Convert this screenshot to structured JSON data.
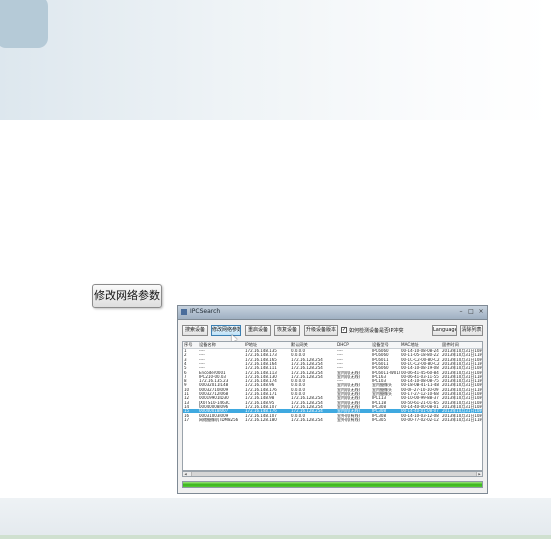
{
  "doc": {
    "callout_button_label": "修改网络参数"
  },
  "app": {
    "title": "IPCSearch",
    "titlebar_buttons": [
      "–",
      "□",
      "×"
    ],
    "toolbar": {
      "search_label": "搜索设备",
      "modify_network_label": "修改网络参数",
      "restart_label": "重启设备",
      "restore_label": "恢复设备",
      "upgrade_label": "升级设备版本",
      "auto_modify_checkbox_checked": true,
      "auto_modify_label": "如何检测设备是否IP冲突",
      "language_label": "Language",
      "clear_list_label": "清除列表"
    },
    "table": {
      "columns": [
        "序号",
        "设备名称",
        "IP地址",
        "默认网关",
        "DHCP",
        "设备型号",
        "MAC地址",
        "固件时间"
      ],
      "selected_row_index": 14,
      "rows": [
        [
          "1",
          "----",
          "172.16.148.135",
          "0.0.0.0",
          "----",
          "IPC6060",
          "00-14-10-08-08-24",
          "2013年10月31日10时"
        ],
        [
          "2",
          "----",
          "172.16.148.173",
          "0.0.0.0",
          "----",
          "IPC6060",
          "00-11-05-18-80-22",
          "2013年10月31日11时"
        ],
        [
          "3",
          "----",
          "172.16.148.165",
          "172.16.128.254",
          "----",
          "IPC6011",
          "00-1C-C2-00-80-C2",
          "2013年10月31日10时"
        ],
        [
          "4",
          "----",
          "172.16.148.164",
          "172.16.128.254",
          "----",
          "IPC6011",
          "00-1C-C2-00-80-C2",
          "2013年10月31日11时"
        ],
        [
          "5",
          "----",
          "172.16.148.111",
          "172.16.128.254",
          "----",
          "IPC6060",
          "00-14-10-08-19-08",
          "2013年10月31日10时"
        ],
        [
          "6",
          "Encoder0001",
          "172.16.148.113",
          "172.16.128.254",
          "室内机(无线)",
          "IPC6011-W010",
          "00-06-41-45-60-84",
          "2013年10月31日10时"
        ],
        [
          "7",
          "IPC210-00.03",
          "172.16.148.130",
          "172.16.128.254",
          "室内机(无线)",
          "IPC163",
          "00-06-41-03-11-55",
          "2013年10月31日11时"
        ],
        [
          "8",
          "172.16.135.23",
          "172.16.148.174",
          "0.0.0.0",
          "----",
          "IPC103",
          "00-14-10-08-08-75",
          "2013年10月31日11时"
        ],
        [
          "9",
          "00032011I148",
          "172.16.148.96",
          "0.0.0.0",
          "室内机(无线)",
          "室内摄像头",
          "00-18-0B-41-11-48",
          "2013年10月31日10时"
        ],
        [
          "10",
          "00032710I009",
          "172.16.148.176",
          "0.0.0.0",
          "室内机(无线)",
          "室内摄像头",
          "00-0F-27-10-10-09",
          "2013年10月31日11时"
        ],
        [
          "11",
          "00032712I068",
          "172.16.148.171",
          "0.0.0.0",
          "室内机(无线)",
          "室内摄像头",
          "00-17-27-12-10-68",
          "2013年10月31日10时"
        ],
        [
          "12",
          "00019901ID30",
          "172.16.148.98",
          "172.16.128.254",
          "室内机(无线)",
          "IPC113",
          "00-10-00-99-88-37",
          "2013年10月31日10时"
        ],
        [
          "13",
          "JX0TS10-1463C",
          "172.16.148.95",
          "172.16.128.254",
          "室内机(无线)",
          "IPC118",
          "00-50-61-21-01-65",
          "2013年10月31日10时"
        ],
        [
          "14",
          "00040008I096",
          "172.16.148.107",
          "172.16.128.254",
          "室内机(无线)",
          "IPC308",
          "00-14-40-00-08-01",
          "2013年10月31日10时"
        ],
        [
          "15",
          "00040018I007",
          "172.16.148.176",
          "172.16.128.254",
          "室内机(无线)",
          "IPC308",
          "00-14-40-01-08-07",
          "2013年10月31日10时"
        ],
        [
          "16",
          "00031003I009",
          "172.16.148.107",
          "0.0.0.0",
          "室外机(有线)",
          "IPC308",
          "00-14-10-03-12-08",
          "2013年10月31日10时"
        ],
        [
          "17",
          "网络摄像机 IDM8256",
          "172.16.128.180",
          "172.16.128.254",
          "室外机(有线)",
          "IPC305",
          "00-00-77-02-02-12",
          "2013年10月31日11时"
        ]
      ]
    },
    "progress": {
      "fraction": 1.0,
      "color": "#37b618"
    }
  }
}
